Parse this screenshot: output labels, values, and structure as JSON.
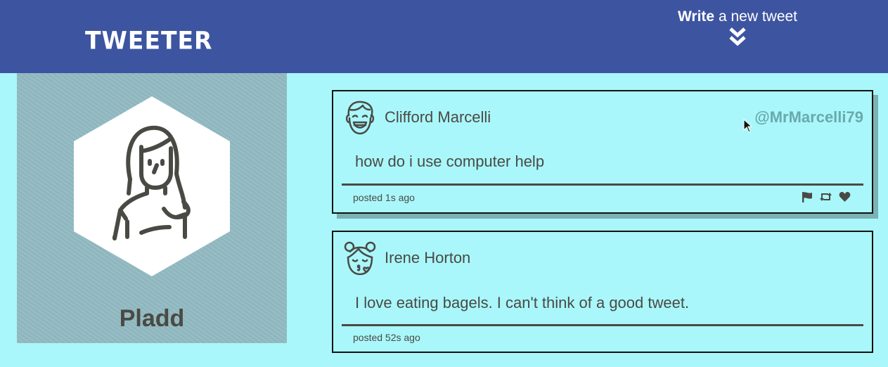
{
  "app": {
    "logo": "TWEETER"
  },
  "compose": {
    "bold": "Write",
    "rest": " a new tweet",
    "icon": "double-chevron-down-icon"
  },
  "profile": {
    "name": "Pladd",
    "avatar_icon": "woman-avatar-icon"
  },
  "tweets": [
    {
      "name": "Clifford Marcelli",
      "handle": "@MrMarcelli79",
      "text": "how do i use computer help",
      "time": "posted 1s ago",
      "avatar_icon": "laughing-man-avatar-icon",
      "actions": [
        "flag-icon",
        "retweet-icon",
        "heart-icon"
      ]
    },
    {
      "name": "Irene Horton",
      "text": "I love eating bagels. I can't think of a good tweet.",
      "time": "posted 52s ago",
      "avatar_icon": "kissing-girl-avatar-icon"
    }
  ],
  "colors": {
    "background": "#a9f7fb",
    "nav": "#3d55a0",
    "profile_bg": "#92bac2",
    "text": "#4a4a44",
    "handle": "#6aa9ad"
  }
}
